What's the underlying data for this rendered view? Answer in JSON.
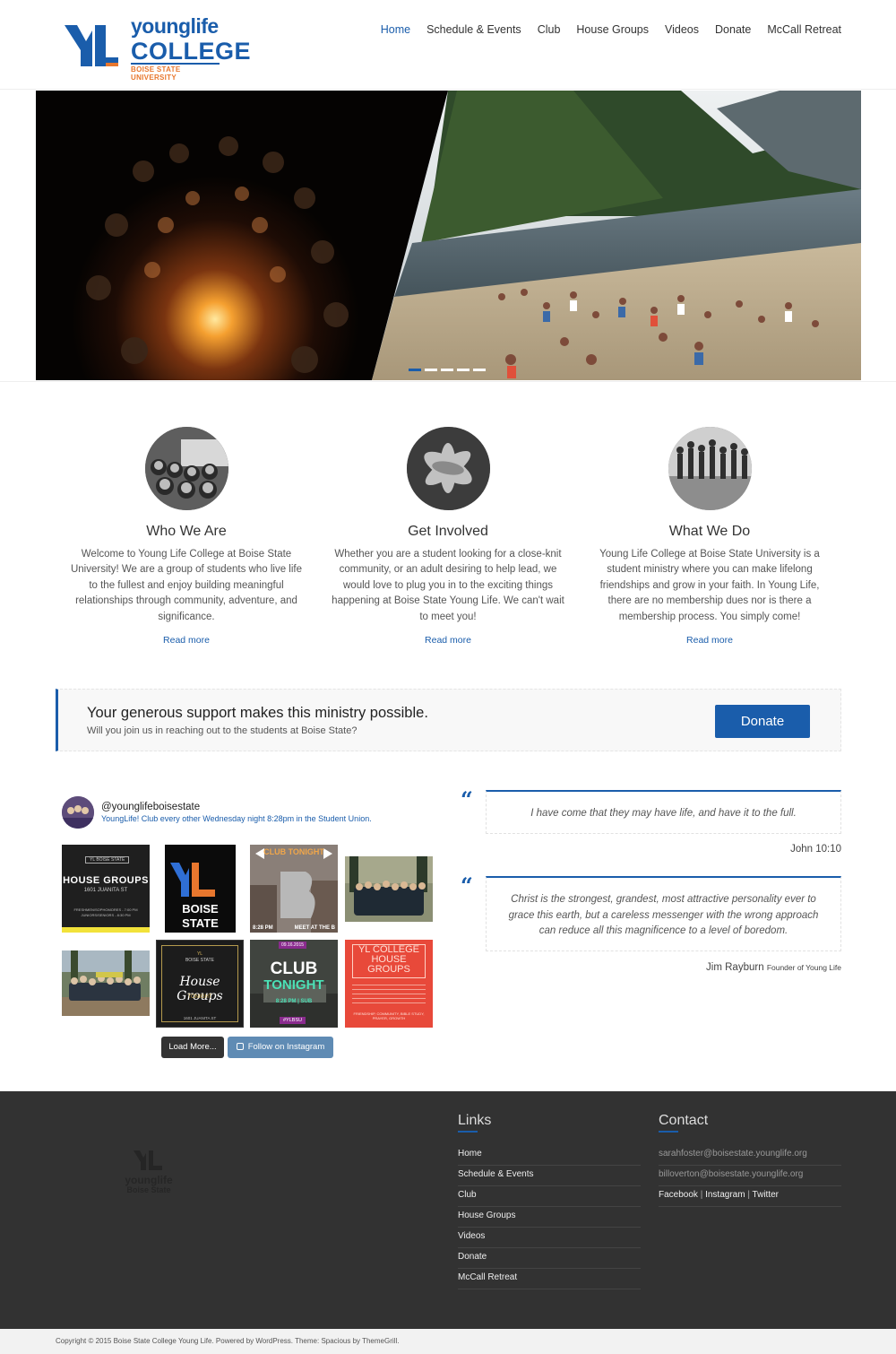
{
  "brand": {
    "top": "younglife",
    "college": "COLLEGE",
    "subtitle": "BOISE STATE UNIVERSITY",
    "color": "#1a5dab",
    "accent": "#e8772e"
  },
  "nav": {
    "items": [
      "Home",
      "Schedule & Events",
      "Club",
      "House Groups",
      "Videos",
      "Donate",
      "McCall Retreat"
    ],
    "active": "Home"
  },
  "slider": {
    "slide_count": 5,
    "active_index": 0
  },
  "features": [
    {
      "title": "Who We Are",
      "text": "Welcome to Young Life College at Boise State University! We are a group of students who live life to the fullest and enjoy building meaningful relationships through community, adventure, and significance.",
      "link": "Read more"
    },
    {
      "title": "Get Involved",
      "text": "Whether you are a student looking for a close-knit community, or an adult desiring to help lead, we would love to plug you in to the exciting things happening at Boise State Young Life. We can't wait to meet you!",
      "link": "Read more"
    },
    {
      "title": "What We Do",
      "text": "Young Life College at Boise State University is a student ministry where you can make lifelong friendships and grow in your faith. In Young Life, there are no membership dues nor is there a membership process. You simply come!",
      "link": "Read more"
    }
  ],
  "cta": {
    "heading": "Your generous support makes this ministry possible.",
    "sub": "Will you join us in reaching out to the students at Boise State?",
    "button": "Donate"
  },
  "instagram": {
    "username": "@younglifeboisestate",
    "bio": "YoungLife! Club every other Wednesday night 8:28pm in the Student Union.",
    "tiles": {
      "t1_badge": "YL BOISE STATE",
      "t1_title": "HOUSE GROUPS",
      "t1_addr": "1601 JUANITA ST",
      "t1_line1": "FRESHMEN/SOPHOMORES - 7:00 PM",
      "t1_line2": "JUNIORS/SENIORS - 8:30 PM",
      "t2_text1": "BOISE",
      "t2_text2": "STATE",
      "t3_title": "CLUB TONIGHT",
      "t3_time": "8:28 PM",
      "t3_meet": "MEET AT THE B",
      "t6_brand1": "YL",
      "t6_brand2": "BOISE STATE",
      "t6_title": "House Groups",
      "t6_sub": "TONIGHT",
      "t6_addr": "1601 JUANITA ST",
      "t7_date": "09.16.2015",
      "t7_title1": "CLUB",
      "t7_title2": "TONIGHT",
      "t7_time": "8:28 PM | SUB",
      "t7_tag": "#YLBSU",
      "t8_title1": "YL COLLEGE",
      "t8_title2": "HOUSE",
      "t8_title3": "GROUPS",
      "t8_foot": "FRIENDSHIP, COMMUNITY, BIBLE STUDY, PRAYER, GROWTH"
    },
    "load_more": "Load More...",
    "follow": "Follow on Instagram"
  },
  "quotes": [
    {
      "text": "I have come that they may have life, and have it to the full.",
      "author": "John 10:10",
      "role": ""
    },
    {
      "text": "Christ is the strongest, grandest, most attractive personality ever to grace this earth, but a careless messenger with the wrong approach can reduce all this magnificence to a level of boredom.",
      "author": "Jim Rayburn",
      "role": "Founder of Young Life"
    }
  ],
  "footer": {
    "logo_top": "younglife",
    "logo_bottom": "Boise State",
    "links_title": "Links",
    "links": [
      "Home",
      "Schedule & Events",
      "Club",
      "House Groups",
      "Videos",
      "Donate",
      "McCall Retreat"
    ],
    "contact_title": "Contact",
    "emails": [
      "sarahfoster@boisestate.younglife.org",
      "billoverton@boisestate.younglife.org"
    ],
    "social": [
      "Facebook",
      "Instagram",
      "Twitter"
    ],
    "copyright": "Copyright © 2015 Boise State College Young Life. Powered by WordPress. Theme: Spacious by ThemeGrill."
  }
}
